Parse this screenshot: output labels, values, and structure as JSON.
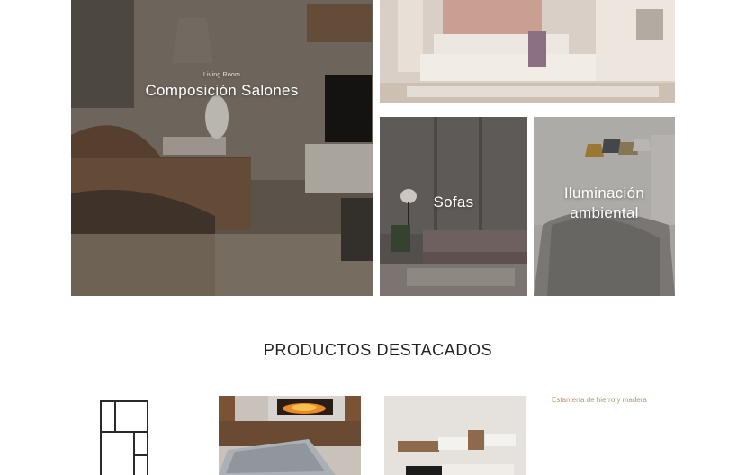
{
  "collections": [
    {
      "title": "Composición Salones",
      "kicker": "Living Room"
    },
    {
      "title": "",
      "kicker": ""
    },
    {
      "title": "Sofas",
      "kicker": ""
    },
    {
      "title": "Iluminación ambiental",
      "kicker": ""
    }
  ],
  "featured": {
    "heading": "PRODUCTOS DESTACADOS",
    "products": [
      {
        "image": "mirror-frame-image",
        "label": ""
      },
      {
        "image": "fireplace-room-image",
        "label": ""
      },
      {
        "image": "wall-unit-image",
        "label": ""
      },
      {
        "image": "",
        "label": "Estantería de hierro y madera"
      }
    ]
  },
  "colors": {
    "accent_text": "#b59673",
    "heading": "#222222",
    "background": "#ffffff"
  }
}
